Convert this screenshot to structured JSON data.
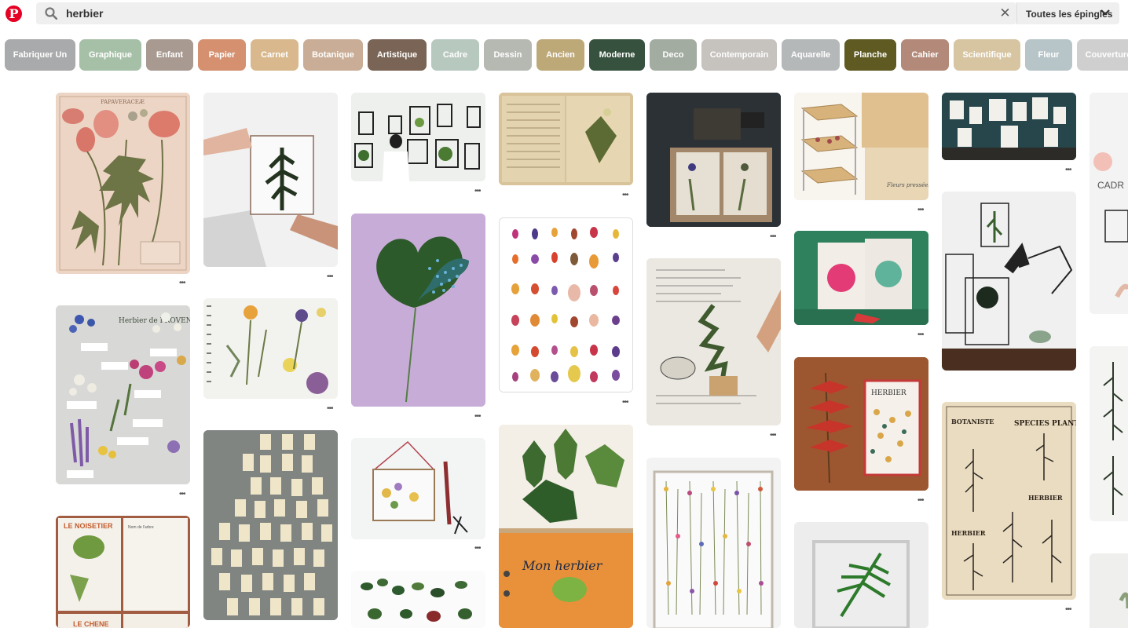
{
  "app": {
    "logo_letter": "P"
  },
  "search": {
    "query": "herbier",
    "scope_label": "Toutes les épingles"
  },
  "icons": {
    "search": "search-icon",
    "clear": "close-icon",
    "scope": "chevron-down-icon",
    "more": "more-icon"
  },
  "guides": [
    {
      "label": "Fabriquer Un",
      "color": "#a9aaab"
    },
    {
      "label": "Graphique",
      "color": "#a6c0a8"
    },
    {
      "label": "Enfant",
      "color": "#a89a91"
    },
    {
      "label": "Papier",
      "color": "#d4906f"
    },
    {
      "label": "Carnet",
      "color": "#d8b88c"
    },
    {
      "label": "Botanique",
      "color": "#c9ad96"
    },
    {
      "label": "Artistique",
      "color": "#7a6455"
    },
    {
      "label": "Cadre",
      "color": "#b7c8bf"
    },
    {
      "label": "Dessin",
      "color": "#b6b9b2"
    },
    {
      "label": "Ancien",
      "color": "#bda878"
    },
    {
      "label": "Moderne",
      "color": "#36513d"
    },
    {
      "label": "Deco",
      "color": "#a3aca0"
    },
    {
      "label": "Contemporain",
      "color": "#c6c2be"
    },
    {
      "label": "Aquarelle",
      "color": "#b5b8b9"
    },
    {
      "label": "Planche",
      "color": "#5e5a22"
    },
    {
      "label": "Cahier",
      "color": "#b38a79"
    },
    {
      "label": "Scientifique",
      "color": "#d7c5a2"
    },
    {
      "label": "Fleur",
      "color": "#b7c5c8"
    },
    {
      "label": "Couverture",
      "color": "#cfcfcf"
    }
  ],
  "pins": {
    "papaveraceae_title": "PAPAVERACEÆ",
    "herbier_provence_title": "Herbier de PROVENCE",
    "noisetier_title": "LE NOISETIER",
    "noisetier_sub": "Nom de l'arbre",
    "chene_title": "LE CHENE",
    "mon_herbier": "Mon herbier",
    "book_title": "HERBIER",
    "species_title": "SPECIES PLANTARUM",
    "botaniste": "BOTANISTE",
    "herbier_a": "HERBIER",
    "herbier_b": "HERBIER",
    "cadre_text": "CADR",
    "fleurs_label": "Fleurs pressées"
  }
}
